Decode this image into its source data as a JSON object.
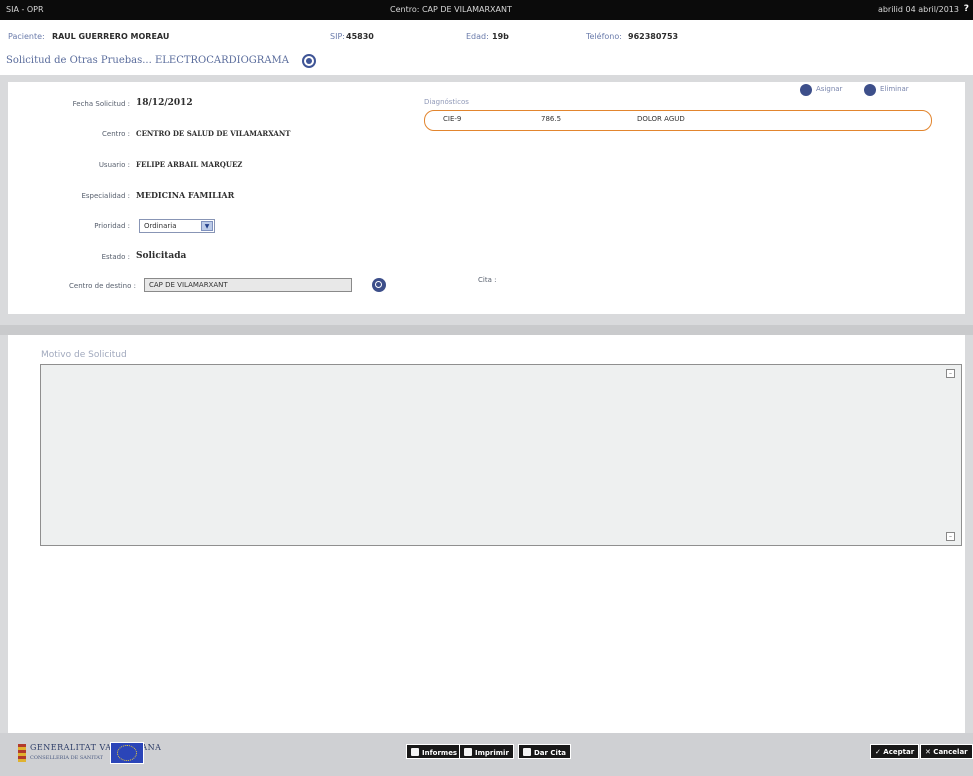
{
  "topbar": {
    "app": "SIA - OPR",
    "center": "Centro: CAP DE VILAMARXANT",
    "user": "abrilid 04 abril/2013",
    "help": "?"
  },
  "patient": {
    "paciente_label": "Paciente:",
    "paciente_value": "RAUL GUERRERO MOREAU",
    "sip_label": "SIP:",
    "sip_value": "45830",
    "edad_label": "Edad:",
    "edad_value": "19b",
    "telefono_label": "Teléfono:",
    "telefono_value": "962380753"
  },
  "title": {
    "text": "Solicitud de Otras Pruebas... ELECTROCARDIOGRAMA"
  },
  "form": {
    "fecha_label": "Fecha Solicitud :",
    "fecha_value": "18/12/2012",
    "centro_label": "Centro :",
    "centro_value": "CENTRO DE SALUD DE VILAMARXANT",
    "usuario_label": "Usuario :",
    "usuario_value": "FELIPE ARBAIL MARQUEZ",
    "especialidad_label": "Especialidad :",
    "especialidad_value": "MEDICINA FAMILIAR",
    "prioridad_label": "Prioridad :",
    "prioridad_value": "Ordinaria",
    "estado_label": "Estado :",
    "estado_value": "Solicitada",
    "destino_label": "Centro de destino :",
    "destino_value": "CAP DE VILAMARXANT",
    "cita_label": "Cita :"
  },
  "diagnosticos": {
    "label": "Diagnósticos",
    "rows": [
      {
        "code_system": "CIE-9",
        "code": "786.5",
        "description": "DOLOR AGUD"
      }
    ],
    "asignar_label": "Asignar",
    "eliminar_label": "Eliminar"
  },
  "motivo": {
    "label": "Motivo de Solicitud"
  },
  "footer": {
    "logo_name": "GENERALITAT VALENCIANA",
    "logo_sub": "CONSELLERIA DE SANITAT",
    "informes_label": "Informes",
    "imprimir_label": "Imprimir",
    "dar_cita_label": "Dar Cita",
    "aceptar_label": "✓ Aceptar",
    "cancelar_label": "✕ Cancelar"
  }
}
